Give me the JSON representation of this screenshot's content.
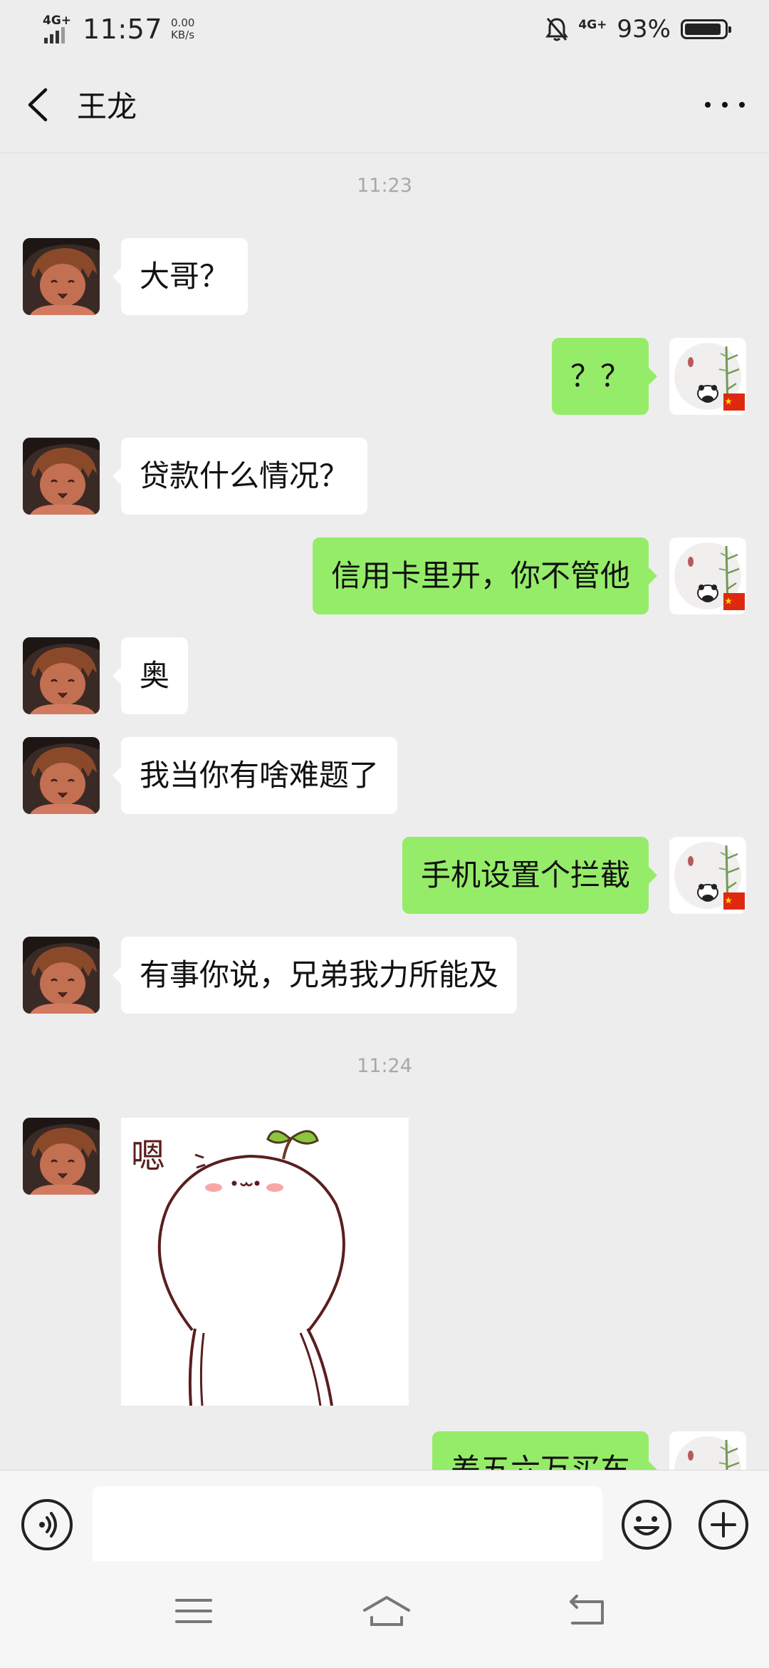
{
  "status_bar": {
    "network_type": "4G+",
    "time": "11:57",
    "speed_value": "0.00",
    "speed_unit": "KB/s",
    "network_type_right": "4G+",
    "battery_percent": "93%",
    "battery_level": 0.93
  },
  "header": {
    "back_icon": "chevron-left-icon",
    "title": "王龙",
    "more_icon": "more-horizontal-icon"
  },
  "chat": {
    "timestamps": [
      "11:23",
      "11:24"
    ],
    "messages": [
      {
        "sender": "contact",
        "text": "大哥？"
      },
      {
        "sender": "me",
        "text": "？？"
      },
      {
        "sender": "contact",
        "text": "贷款什么情况？"
      },
      {
        "sender": "me",
        "text": "信用卡里开，你不管他"
      },
      {
        "sender": "contact",
        "text": "奥"
      },
      {
        "sender": "contact",
        "text": "我当你有啥难题了"
      },
      {
        "sender": "me",
        "text": "手机设置个拦截"
      },
      {
        "sender": "contact",
        "text": "有事你说，兄弟我力所能及"
      },
      {
        "sender": "contact",
        "type": "sticker",
        "text": "嗯"
      },
      {
        "sender": "me",
        "text": "差五六万买车"
      }
    ]
  },
  "input_bar": {
    "voice_icon": "voice-input-icon",
    "text_value": "",
    "emoji_icon": "emoji-icon",
    "plus_icon": "plus-circle-icon"
  },
  "nav_bar": {
    "icons": [
      "menu-icon",
      "home-icon",
      "back-icon"
    ]
  },
  "colors": {
    "background": "#ededed",
    "outgoing_bubble": "#95ec69",
    "incoming_bubble": "#ffffff",
    "timestamp": "#a8a8a8"
  }
}
